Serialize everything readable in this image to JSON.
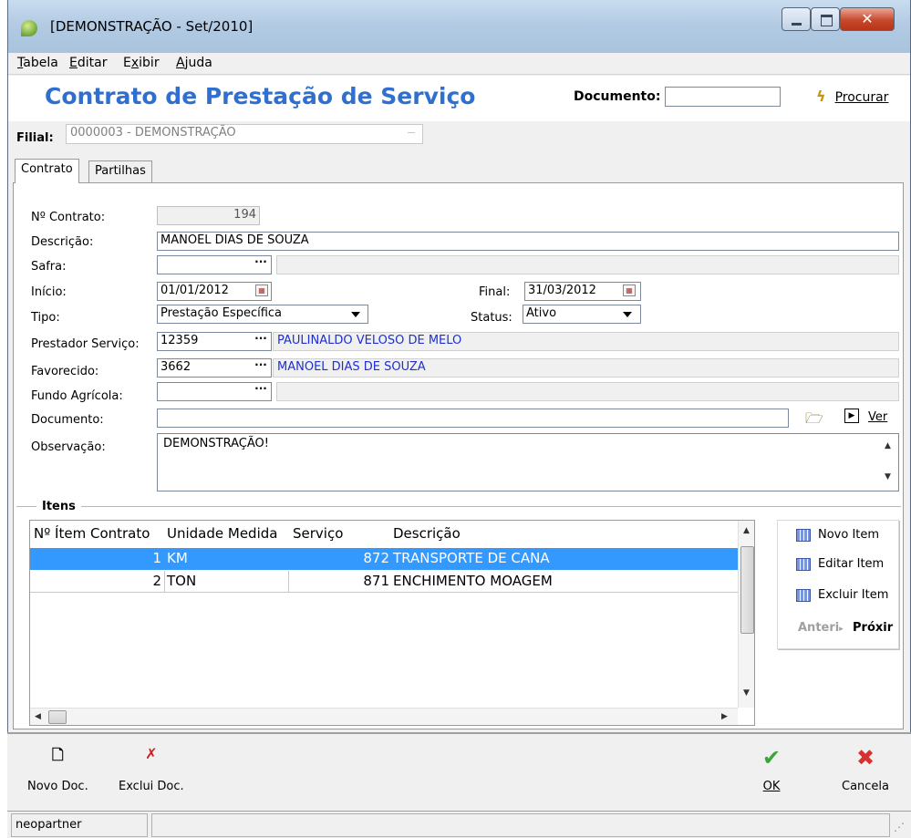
{
  "window": {
    "title": "[DEMONSTRAÇÃO - Set/2010]"
  },
  "menu": {
    "items": [
      "Tabela",
      "Editar",
      "Exibir",
      "Ajuda"
    ],
    "underlined": [
      "T",
      "E",
      "x",
      "A"
    ]
  },
  "header": {
    "title": "Contrato de Prestação de Serviço",
    "documento_label": "Documento:",
    "documento_value": "",
    "procurar_label": "Procurar"
  },
  "filial": {
    "label": "Filial:",
    "value": "0000003 - DEMONSTRAÇÃO"
  },
  "tabs": [
    "Contrato",
    "Partilhas"
  ],
  "form": {
    "contrato_label": "Nº Contrato:",
    "contrato_value": "194",
    "descricao_label": "Descrição:",
    "descricao_value": "MANOEL DIAS DE SOUZA",
    "safra_label": "Safra:",
    "safra_value": "",
    "inicio_label": "Início:",
    "inicio_value": "01/01/2012",
    "final_label": "Final:",
    "final_value": "31/03/2012",
    "tipo_label": "Tipo:",
    "tipo_value": "Prestação Específica",
    "status_label": "Status:",
    "status_value": "Ativo",
    "prestador_label": "Prestador Serviço:",
    "prestador_code": "12359",
    "prestador_name": "PAULINALDO VELOSO DE MELO",
    "favorecido_label": "Favorecido:",
    "favorecido_code": "3662",
    "favorecido_name": "MANOEL DIAS DE SOUZA",
    "fundo_label": "Fundo Agrícola:",
    "fundo_code": "",
    "documento_label": "Documento:",
    "documento_value": "",
    "ver_label": "Ver",
    "observacao_label": "Observação:",
    "observacao_value": "DEMONSTRAÇÃO!"
  },
  "itens": {
    "label": "Itens",
    "columns": [
      "Nº Ítem Contrato",
      "Unidade Medida",
      "Serviço",
      "Descrição"
    ],
    "rows": [
      {
        "item": "1",
        "unidade": "KM",
        "servico": "872",
        "descricao": "TRANSPORTE DE CANA",
        "selected": true
      },
      {
        "item": "2",
        "unidade": "TON",
        "servico": "871",
        "descricao": "ENCHIMENTO MOAGEM",
        "selected": false
      }
    ],
    "buttons": {
      "novo": "Novo Item",
      "editar": "Editar Item",
      "excluir": "Excluir Item"
    },
    "nav": {
      "anterior": "Anteri",
      "proximo": "Próxir"
    }
  },
  "toolbar": {
    "novo_doc": "Novo Doc.",
    "exclui_doc": "Exclui Doc.",
    "ok": "OK",
    "cancela": "Cancela"
  },
  "status": {
    "user": "neopartner"
  },
  "colors": {
    "title_blue": "#2f6fd0",
    "selection": "#3399ff",
    "link_text": "#1f2fd0"
  }
}
